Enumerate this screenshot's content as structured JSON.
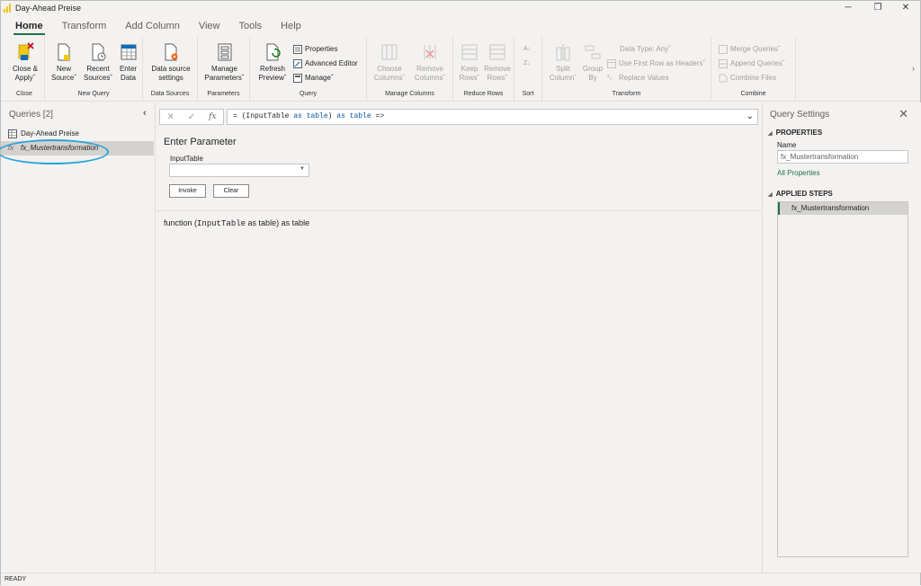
{
  "window": {
    "title": "Day-Ahead Preise"
  },
  "tabs": [
    "Home",
    "Transform",
    "Add Column",
    "View",
    "Tools",
    "Help"
  ],
  "ribbon": {
    "close": {
      "close_apply": "Close &",
      "close_apply2": "Apply",
      "group": "Close"
    },
    "new_query": {
      "new_source": "New",
      "new_source2": "Source",
      "recent": "Recent",
      "recent2": "Sources",
      "enter": "Enter",
      "enter2": "Data",
      "group": "New Query"
    },
    "data_sources": {
      "settings": "Data source",
      "settings2": "settings",
      "group": "Data Sources"
    },
    "parameters": {
      "manage": "Manage",
      "manage2": "Parameters",
      "group": "Parameters"
    },
    "query": {
      "refresh": "Refresh",
      "refresh2": "Preview",
      "properties": "Properties",
      "advanced": "Advanced Editor",
      "manage": "Manage",
      "group": "Query"
    },
    "manage_columns": {
      "choose": "Choose",
      "choose2": "Columns",
      "remove": "Remove",
      "remove2": "Columns",
      "group": "Manage Columns"
    },
    "reduce_rows": {
      "keep": "Keep",
      "keep2": "Rows",
      "remove": "Remove",
      "remove2": "Rows",
      "group": "Reduce Rows"
    },
    "sort": {
      "group": "Sort"
    },
    "transform": {
      "split": "Split",
      "split2": "Column",
      "group_by": "Group",
      "group_by2": "By",
      "data_type": "Data Type: Any",
      "first_row": "Use First Row as Headers",
      "replace": "Replace Values",
      "group": "Transform"
    },
    "combine": {
      "merge": "Merge Queries",
      "append": "Append Queries",
      "combine_files": "Combine Files",
      "group": "Combine"
    }
  },
  "queries": {
    "header": "Queries [2]",
    "items": [
      "Day-Ahead Preise",
      "fx_Mustertransformation"
    ]
  },
  "formula": {
    "prefix": "= (",
    "param": "InputTable",
    "as1": "as",
    "type1": "table",
    "close": ") ",
    "as2": "as",
    "type2": "table",
    "arrow": " =>"
  },
  "parameter_form": {
    "title": "Enter Parameter",
    "label": "InputTable",
    "select_value": "",
    "invoke": "Invoke",
    "clear": "Clear"
  },
  "signature": {
    "pre": "function (",
    "param": "InputTable",
    "post": " as table) as table"
  },
  "settings": {
    "title": "Query Settings",
    "properties_head": "PROPERTIES",
    "name_label": "Name",
    "name_value": "fx_Mustertransformation",
    "all_properties": "All Properties",
    "steps_head": "APPLIED STEPS",
    "steps": [
      "fx_Mustertransformation"
    ]
  },
  "status": "READY",
  "colors": {
    "accent": "#217346",
    "highlight_ring": "#29a3d8"
  }
}
